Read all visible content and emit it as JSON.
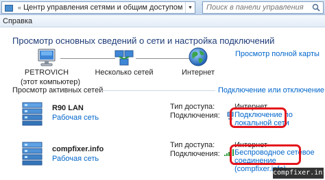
{
  "address_bar": {
    "breadcrumb_sep": "«",
    "path": "Центр управления сетями и общим доступом",
    "dropdown_glyph": "▼",
    "refresh_glyph": "↻",
    "search_placeholder": "Поиск в панели управления"
  },
  "menu": {
    "help": "Справка"
  },
  "main": {
    "title": "Просмотр основных сведений о сети и настройка подключений",
    "view_full_map": "Просмотр полной карты"
  },
  "map": {
    "computer_name": "PETROVICH",
    "computer_sub": "(этот компьютер)",
    "networks": "Несколько сетей",
    "internet": "Интернет"
  },
  "active_networks": {
    "label": "Просмотр активных сетей",
    "connect_disconnect": "Подключение или отключение",
    "items": [
      {
        "name": "R90 LAN",
        "type": "Рабочая сеть",
        "access_label": "Тип доступа:",
        "access_value": "Интернет",
        "connections_label": "Подключения:",
        "connection_line1": "Подключение по",
        "connection_line2": "локальной сети",
        "connection_line3": "",
        "icon": "ethernet-icon"
      },
      {
        "name": "compfixer.info",
        "type": "Рабочая сеть",
        "access_label": "Тип доступа:",
        "access_value": "Интернет",
        "connections_label": "Подключения:",
        "connection_line1": "Беспроводное сетевое",
        "connection_line2": "соединение",
        "connection_line3": "(compfixer.info)",
        "icon": "wifi-signal-icon"
      }
    ]
  },
  "watermark": "compfixer.info",
  "colors": {
    "link": "#0066cc",
    "title": "#1e3c78",
    "highlight": "#e3141b"
  }
}
